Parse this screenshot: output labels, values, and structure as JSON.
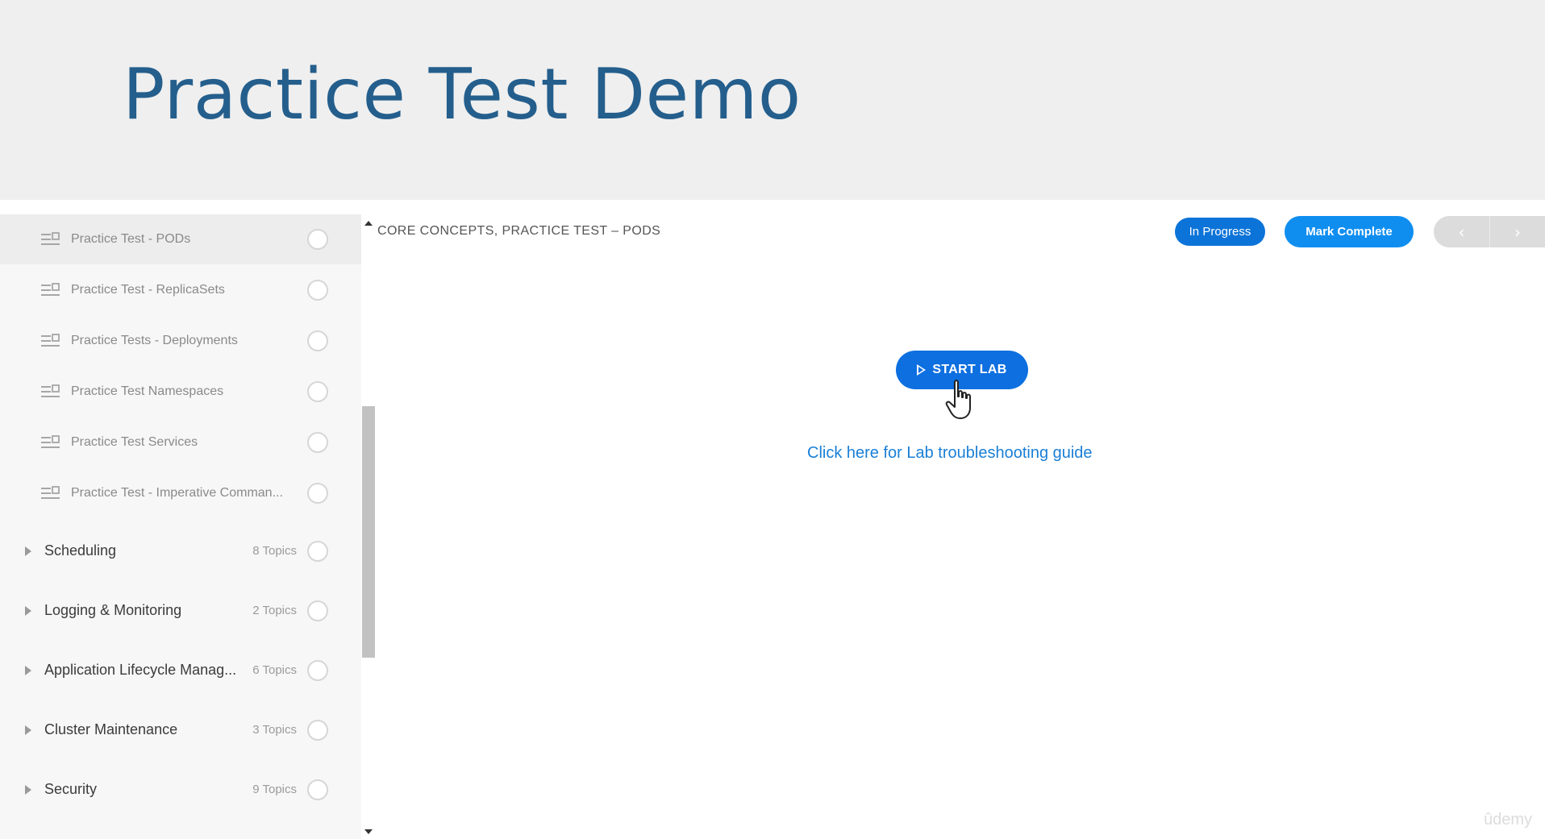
{
  "banner": {
    "title": "Practice Test Demo"
  },
  "sidebar": {
    "lessons": [
      {
        "label": "Practice Test - PODs"
      },
      {
        "label": "Practice Test - ReplicaSets"
      },
      {
        "label": "Practice Tests - Deployments"
      },
      {
        "label": "Practice Test Namespaces"
      },
      {
        "label": "Practice Test Services"
      },
      {
        "label": "Practice Test - Imperative Comman..."
      }
    ],
    "sections": [
      {
        "label": "Scheduling",
        "count": "8 Topics"
      },
      {
        "label": "Logging & Monitoring",
        "count": "2 Topics"
      },
      {
        "label": "Application Lifecycle Manag...",
        "count": "6 Topics"
      },
      {
        "label": "Cluster Maintenance",
        "count": "3 Topics"
      },
      {
        "label": "Security",
        "count": "9 Topics"
      }
    ]
  },
  "main": {
    "breadcrumb": "CORE CONCEPTS, PRACTICE TEST – PODS",
    "status_label": "In Progress",
    "complete_label": "Mark Complete",
    "prev_label": "‹",
    "next_label": "›",
    "start_lab_label": "START LAB",
    "guide_link": "Click here for Lab troubleshooting guide"
  },
  "watermark": "ûdemy",
  "colors": {
    "title": "#245e8c",
    "primary": "#0c74d8",
    "link": "#1a7fd6"
  }
}
